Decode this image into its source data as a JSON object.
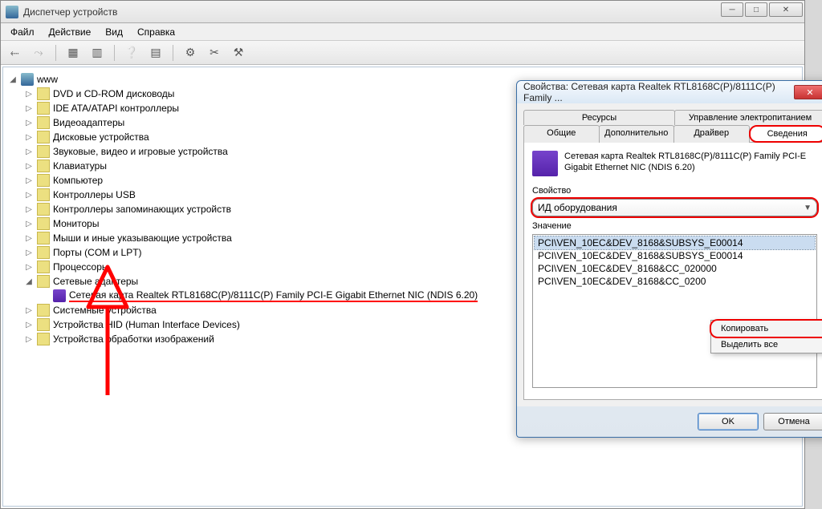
{
  "main": {
    "title": "Диспетчер устройств",
    "menu": {
      "file": "Файл",
      "action": "Действие",
      "view": "Вид",
      "help": "Справка"
    },
    "root_node": "www",
    "categories": [
      "DVD и CD-ROM дисководы",
      "IDE ATA/ATAPI контроллеры",
      "Видеоадаптеры",
      "Дисковые устройства",
      "Звуковые, видео и игровые устройства",
      "Клавиатуры",
      "Компьютер",
      "Контроллеры USB",
      "Контроллеры запоминающих устройств",
      "Мониторы",
      "Мыши и иные указывающие устройства",
      "Порты (COM и LPT)",
      "Процессоры"
    ],
    "net_adapters_label": "Сетевые адаптеры",
    "selected_device": "Сетевая карта Realtek RTL8168C(P)/8111C(P) Family PCI-E Gigabit Ethernet NIC (NDIS 6.20)",
    "categories_after": [
      "Системные устройства",
      "Устройства HID (Human Interface Devices)",
      "Устройства обработки изображений"
    ]
  },
  "dialog": {
    "title": "Свойства: Сетевая карта Realtek RTL8168C(P)/8111C(P) Family ...",
    "tabs_row1": [
      "Ресурсы",
      "Управление электропитанием"
    ],
    "tabs_row2": [
      "Общие",
      "Дополнительно",
      "Драйвер",
      "Сведения"
    ],
    "device_name": "Сетевая карта Realtek RTL8168C(P)/8111C(P) Family PCI-E Gigabit Ethernet NIC (NDIS 6.20)",
    "property_label": "Свойство",
    "property_value": "ИД оборудования",
    "value_label": "Значение",
    "values": [
      "PCI\\VEN_10EC&DEV_8168&SUBSYS_E00014",
      "PCI\\VEN_10EC&DEV_8168&SUBSYS_E00014",
      "PCI\\VEN_10EC&DEV_8168&CC_020000",
      "PCI\\VEN_10EC&DEV_8168&CC_0200"
    ],
    "ok": "OK",
    "cancel": "Отмена",
    "context": {
      "copy": "Копировать",
      "select_all": "Выделить все"
    }
  }
}
